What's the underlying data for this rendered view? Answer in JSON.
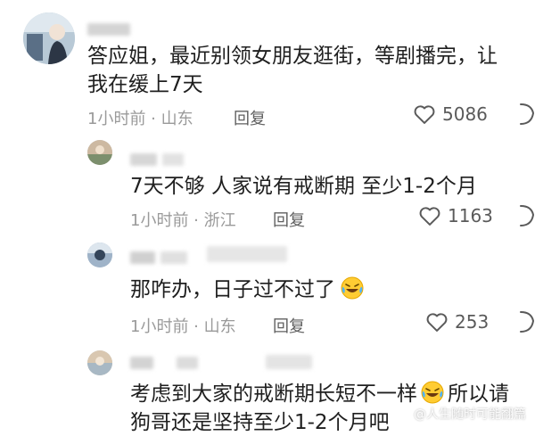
{
  "comments": [
    {
      "text_lines": [
        "答应姐，最近别领女朋友逛街，等剧播完，让",
        "我在缓上7天"
      ],
      "time": "1小时前",
      "location": "山东",
      "reply_label": "回复",
      "likes": "5086"
    },
    {
      "text": "7天不够 人家说有戒断期 至少1-2个月",
      "time": "1小时前",
      "location": "浙江",
      "reply_label": "回复",
      "likes": "1163"
    },
    {
      "text": "那咋办，日子过不过了",
      "emoji": "laughing-crying-emoji",
      "time": "1小时前",
      "location": "山东",
      "reply_label": "回复",
      "likes": "253"
    },
    {
      "text_lines": [
        "考虑到大家的戒断期长短不一样",
        "所以请",
        "狗哥还是坚持至少1-2个月吧"
      ],
      "emoji": "laughing-crying-emoji"
    }
  ],
  "watermark": "@人生随时可能翻篇",
  "icons": {
    "like": "heart-outline-icon",
    "dislike": "dislike-icon",
    "emoji": "laughing-crying-emoji"
  },
  "colors": {
    "text": "#1f1f1f",
    "meta": "#9a9a9a",
    "icon": "#5a5a5a"
  }
}
